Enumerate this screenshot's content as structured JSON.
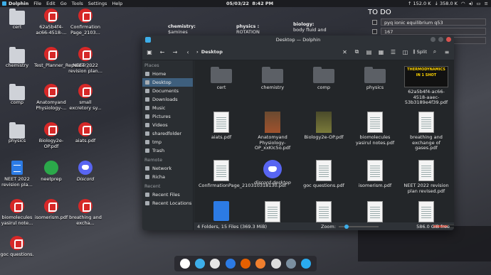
{
  "panel": {
    "app_name": "Dolphin",
    "menus": [
      "File",
      "Edit",
      "Go",
      "Tools",
      "Settings",
      "Help"
    ],
    "date": "05/03/22",
    "time": "8:42 PM",
    "upload": "152.0 K",
    "download": "358.0 K"
  },
  "desktop_icons": [
    {
      "label": "cert",
      "type": "folder"
    },
    {
      "label": "62a5b4f4-ac66-4518-...",
      "type": "pdf"
    },
    {
      "label": "Confirmation Page_2103...",
      "type": "pdf"
    },
    {
      "label": "chemistry",
      "type": "folder"
    },
    {
      "label": "Test_Planner_Repeater_...",
      "type": "pdf"
    },
    {
      "label": "NEET 2022 revision plan...",
      "type": "pdf"
    },
    {
      "label": "comp",
      "type": "folder"
    },
    {
      "label": "Anatomyand Physiology-...",
      "type": "pdf"
    },
    {
      "label": "small excretory sy...",
      "type": "pdf"
    },
    {
      "label": "physics",
      "type": "folder"
    },
    {
      "label": "Biology2e-OP.pdf",
      "type": "pdf"
    },
    {
      "label": "aiats.pdf",
      "type": "pdf"
    },
    {
      "label": "NEET 2022 revision pla...",
      "type": "doc"
    },
    {
      "label": "neetprep",
      "type": "grad"
    },
    {
      "label": "Discord",
      "type": "discord"
    },
    {
      "label": "biomolecules yasirul note...",
      "type": "pdf"
    },
    {
      "label": "isomerism.pdf",
      "type": "pdf"
    },
    {
      "label": "breathing and excha...",
      "type": "pdf"
    },
    {
      "label": "goc questions.",
      "type": "pdf"
    }
  ],
  "notes": {
    "chem_title": "chemistry:",
    "chem_line": "$amines",
    "phys_title": "physics :",
    "phys_line": "ROTATION",
    "bio_title": "biology:",
    "bio_line": "body fluid and"
  },
  "todo": {
    "title": "TO DO",
    "items": [
      "pyq ionic equilibrium q53",
      "167",
      ""
    ]
  },
  "window": {
    "title": "Desktop — Dolphin",
    "breadcrumb": "Desktop",
    "split_label": "Split",
    "places_header": "Places",
    "places": [
      "Home",
      "Desktop",
      "Documents",
      "Downloads",
      "Music",
      "Pictures",
      "Videos",
      "sharedfolder",
      "tmp",
      "Trash"
    ],
    "remote_header": "Remote",
    "remote": [
      "Network",
      "Richa"
    ],
    "recent_header": "Recent",
    "recent": [
      "Recent Files",
      "Recent Locations"
    ],
    "files": [
      {
        "name": "cert",
        "thumb": "folder"
      },
      {
        "name": "chemistry",
        "thumb": "folder"
      },
      {
        "name": "comp",
        "thumb": "folder"
      },
      {
        "name": "physics",
        "thumb": "folder"
      },
      {
        "name": "62a5b4f4-ac66-4518-aaec-53b3189e4f39.pdf",
        "thumb": "thermo"
      },
      {
        "name": "aiats.pdf",
        "thumb": "page"
      },
      {
        "name": "Anatomyand Physiology-OP_xxKIc5o.pdf",
        "thumb": "brown"
      },
      {
        "name": "Biology2e-OP.pdf",
        "thumb": "olive"
      },
      {
        "name": "biomolecules yasirul notes.pdf",
        "thumb": "page"
      },
      {
        "name": "breathing and exchange of gases.pdf",
        "thumb": "page"
      },
      {
        "name": "ConfirmationPage_210310318130.pdf",
        "thumb": "page"
      },
      {
        "name": "discord.desktop",
        "thumb": "discord"
      },
      {
        "name": "goc questions.pdf",
        "thumb": "page"
      },
      {
        "name": "isomerism.pdf",
        "thumb": "page"
      },
      {
        "name": "NEET 2022 revision plan revised.pdf",
        "thumb": "page"
      },
      {
        "name": "",
        "thumb": "doc"
      },
      {
        "name": "",
        "thumb": "page"
      },
      {
        "name": "",
        "thumb": "page"
      },
      {
        "name": "",
        "thumb": "page"
      },
      {
        "name": "",
        "thumb": "page"
      }
    ],
    "thermo_thumb_text": "THERMODYNAMICS IN 1 SHOT",
    "status_counts": "4 Folders, 15 Files (369.3 MiB)",
    "zoom_label": "Zoom:",
    "free_space": "586.0 GiB free"
  },
  "colors": {
    "accent": "#3daee9",
    "pdf_red": "#d62828",
    "selection": "#3e5f7d"
  }
}
